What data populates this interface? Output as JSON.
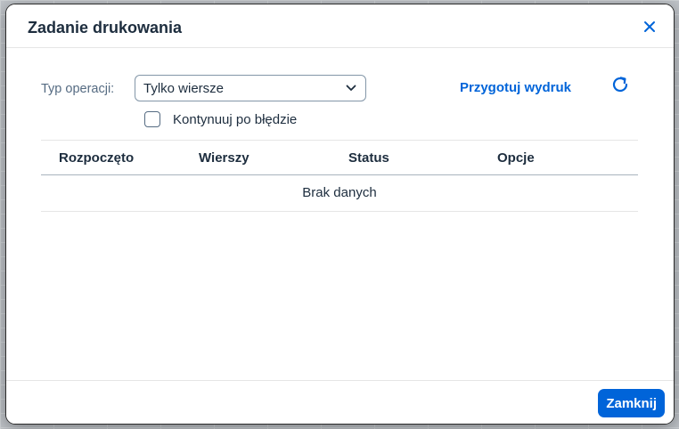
{
  "dialog": {
    "title": "Zadanie drukowania",
    "close_icon": "close-icon"
  },
  "form": {
    "operation_label": "Typ operacji:",
    "operation_value": "Tylko wiersze",
    "prepare_link": "Przygotuj wydruk",
    "refresh_icon": "refresh-icon",
    "continue_on_error_label": "Kontynuuj po błędzie",
    "continue_on_error_checked": false
  },
  "table": {
    "columns": [
      "Rozpoczęto",
      "Wierszy",
      "Status",
      "Opcje"
    ],
    "rows": [],
    "no_data_text": "Brak danych"
  },
  "footer": {
    "close_button": "Zamknij"
  },
  "colors": {
    "accent": "#0064d9",
    "text": "#1d2d3e",
    "label": "#556b82"
  }
}
